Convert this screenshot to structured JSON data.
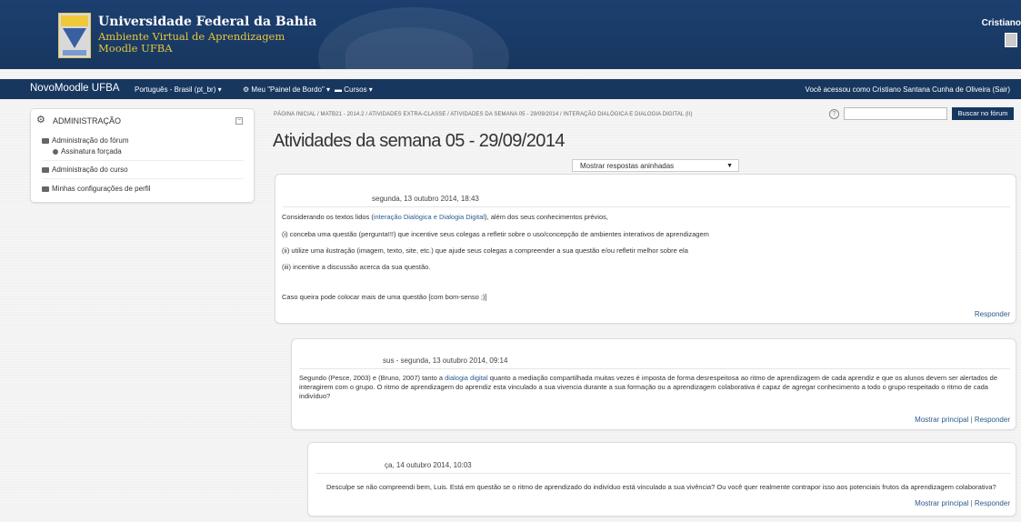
{
  "header": {
    "university": "Universidade Federal da Bahia",
    "environment": "Ambiente Virtual de Aprendizagem",
    "moodle": "Moodle UFBA",
    "user_name": "Cristiano"
  },
  "navbar": {
    "brand": "NovoMoodle UFBA",
    "language": "Português - Brasil (pt_br) ▾",
    "dashboard": "Meu \"Painel de Bordo\" ▾",
    "courses": "Cursos ▾",
    "login_text": "Você acessou como Cristiano Santana Cunha de Oliveira (Sair)"
  },
  "admin_block": {
    "title": "ADMINISTRAÇÃO",
    "items": [
      {
        "label": "Administração do fórum"
      },
      {
        "label": "Assinatura forçada"
      },
      {
        "label": "Administração do curso"
      },
      {
        "label": "Minhas configurações de perfil"
      }
    ]
  },
  "breadcrumb": "PÁGINA INICIAL  /  MATB21 - 2014.2  /  ATIVIDADES EXTRA-CLASSE  /  ATIVIDADES DA SEMANA 05 - 29/09/2014  /  INTERAÇÃO DIALÓGICA E DIALOGIA DIGITAL (II)",
  "search": {
    "button": "Buscar no fórum",
    "value": ""
  },
  "page_title": "Atividades da semana 05 - 29/09/2014",
  "display_mode": "Mostrar respostas aninhadas",
  "posts": [
    {
      "meta": "segunda, 13 outubro 2014, 18:43",
      "lines": [
        "Considerando os textos lidos (",
        "interação Dialógica e Dialogia Digital",
        "), além dos seus conhecimentos prévios,",
        "(i) conceba uma questão (pergunta!!!) que incentive seus colegas a refletir sobre o uso/concepção de ambientes interativos de aprendizagem",
        "(ii) utilize uma ilustração (imagem, texto, site, etc.) que ajude seus colegas a compreender a sua questão e/ou refletir melhor sobre ela",
        "(iii) incentive a discussão acerca da sua questão.",
        "Caso queira pode colocar mais de uma questão [com bom-senso ;)]"
      ],
      "reply": "Responder"
    },
    {
      "meta": "sus - segunda, 13 outubro 2014, 09:14",
      "text_a": "Segundo (Pesce, 2003) e (Bruno, 2007) tanto a ",
      "link": "dialogia digital",
      "text_b": " quanto a mediação compartilhada muitas vezes é imposta de forma desrespeitosa ao ritmo de aprendizagem de cada aprendiz e que os alunos devem ser alertados de interagirem com o grupo. O ritmo de aprendizagem do aprendiz esta vinculado a sua vivencia durante a sua formação ou a aprendizagem colaborativa é capaz de agregar conhecimento a todo o grupo respeitado o ritmo de cada indivíduo?",
      "show_parent": "Mostrar principal",
      "reply": "Responder"
    },
    {
      "meta": "ça, 14 outubro 2014, 10:03",
      "text": "Desculpe se não compreendi bem, Luis. Está em questão se o ritmo de aprendizado do indivíduo está vinculado a sua vivência? Ou você quer realmente contrapor isso aos potenciais frutos da aprendizagem colaborativa?",
      "show_parent": "Mostrar principal",
      "reply": "Responder"
    }
  ],
  "action_separator": "|",
  "icons": [
    "gears-icon",
    "collapse-icon",
    "folder-icon",
    "dot-icon",
    "help-icon",
    "dashboard-icon",
    "courses-icon",
    "chevron-down-icon",
    "avatar"
  ]
}
